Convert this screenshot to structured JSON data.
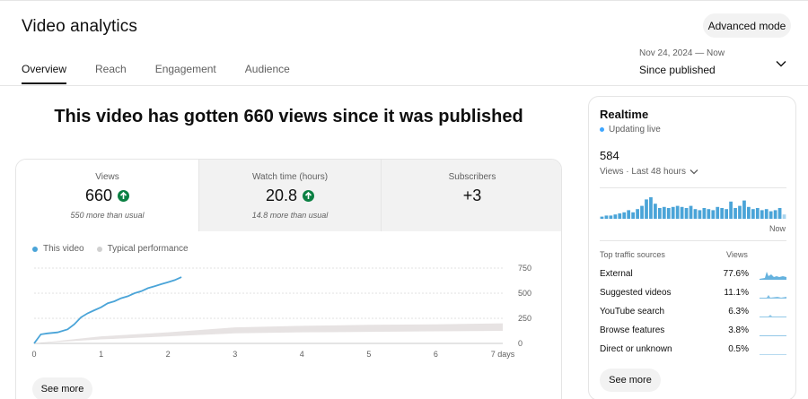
{
  "header": {
    "title": "Video analytics",
    "advanced_mode_label": "Advanced mode"
  },
  "tabs": [
    {
      "label": "Overview",
      "active": true
    },
    {
      "label": "Reach",
      "active": false
    },
    {
      "label": "Engagement",
      "active": false
    },
    {
      "label": "Audience",
      "active": false
    }
  ],
  "date_range": {
    "range": "Nov 24, 2024 — Now",
    "label": "Since published"
  },
  "headline": "This video has gotten 660 views since it was published",
  "metrics": [
    {
      "label": "Views",
      "value": "660",
      "trend_up": true,
      "comparison": "550 more than usual"
    },
    {
      "label": "Watch time (hours)",
      "value": "20.8",
      "trend_up": true,
      "comparison": "14.8 more than usual"
    },
    {
      "label": "Subscribers",
      "value": "+3",
      "trend_up": false,
      "comparison": ""
    }
  ],
  "chart_legend": {
    "this_video": "This video",
    "typical": "Typical performance"
  },
  "chart_data": {
    "type": "line",
    "x_ticks": [
      "0",
      "1",
      "2",
      "3",
      "4",
      "5",
      "6",
      "7 days"
    ],
    "y_ticks": [
      "0",
      "250",
      "500",
      "750"
    ],
    "xlim": [
      0,
      7
    ],
    "ylim": [
      0,
      750
    ],
    "series": [
      {
        "name": "This video",
        "x": [
          0,
          0.1,
          0.2,
          0.35,
          0.5,
          0.6,
          0.7,
          0.8,
          0.9,
          1.0,
          1.1,
          1.2,
          1.3,
          1.4,
          1.5,
          1.6,
          1.7,
          1.8,
          1.9,
          2.0,
          2.1,
          2.2
        ],
        "y": [
          0,
          90,
          100,
          110,
          140,
          190,
          260,
          300,
          330,
          360,
          400,
          420,
          450,
          470,
          500,
          520,
          550,
          570,
          590,
          610,
          630,
          660
        ]
      }
    ],
    "typical_band": {
      "name": "Typical performance",
      "x": [
        0,
        1,
        2,
        3,
        4,
        5,
        6,
        7
      ],
      "low": [
        0,
        40,
        70,
        100,
        110,
        115,
        120,
        125
      ],
      "high": [
        0,
        70,
        110,
        160,
        175,
        185,
        190,
        200
      ]
    },
    "grid": true
  },
  "see_more_label": "See more",
  "realtime": {
    "title": "Realtime",
    "status": "Updating live",
    "count": "584",
    "views_label": "Views · Last 48 hours",
    "now_label": "Now",
    "bars": [
      2,
      3,
      3,
      4,
      5,
      6,
      8,
      6,
      9,
      12,
      18,
      20,
      14,
      10,
      11,
      10,
      11,
      12,
      11,
      10,
      12,
      9,
      8,
      10,
      9,
      8,
      11,
      10,
      9,
      16,
      10,
      12,
      17,
      11,
      9,
      10,
      8,
      9,
      7,
      8,
      10,
      4
    ],
    "traffic_header": "Top traffic sources",
    "traffic_views_header": "Views",
    "sources": [
      {
        "name": "External",
        "pct": "77.6%"
      },
      {
        "name": "Suggested videos",
        "pct": "11.1%"
      },
      {
        "name": "YouTube search",
        "pct": "6.3%"
      },
      {
        "name": "Browse features",
        "pct": "3.8%"
      },
      {
        "name": "Direct or unknown",
        "pct": "0.5%"
      }
    ],
    "see_more_label": "See more"
  },
  "colors": {
    "accent": "#3ea6ff",
    "series": "#4aa4d8",
    "typical": "#e7e3e3",
    "positive": "#0b8043"
  }
}
